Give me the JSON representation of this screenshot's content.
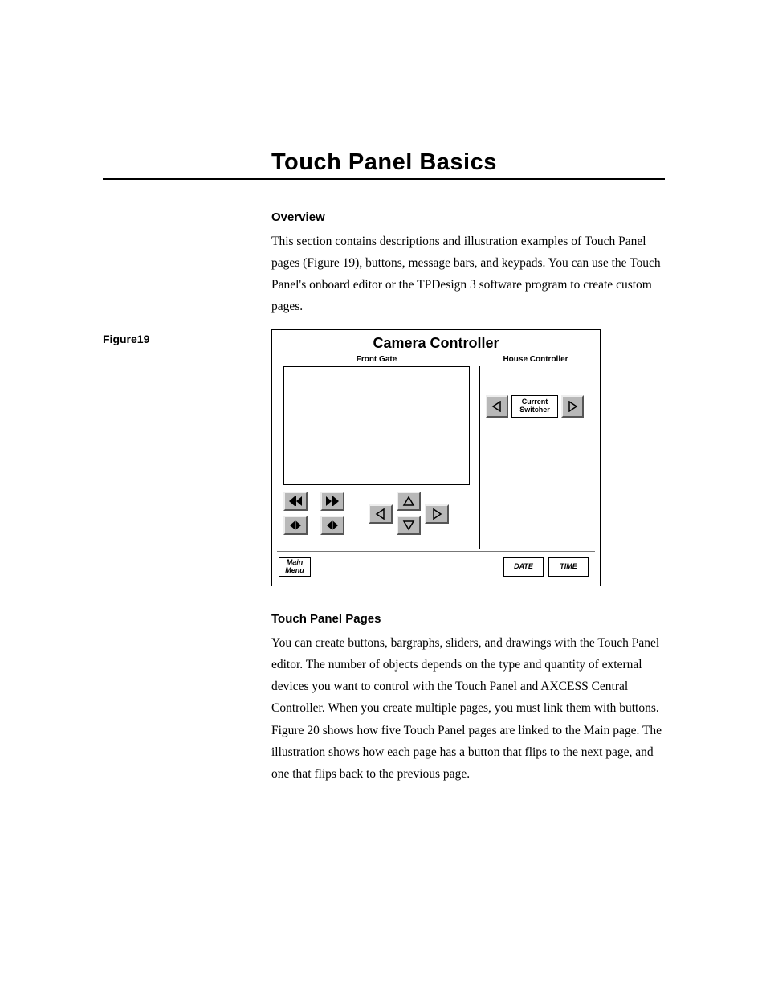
{
  "title": "Touch Panel Basics",
  "sections": {
    "overview": {
      "heading": "Overview",
      "body": "This section contains descriptions and illustration examples of Touch Panel pages (Figure 19), buttons, message bars, and keypads. You can use the Touch Panel's onboard editor or the TPDesign 3 software program to create custom pages."
    },
    "pages": {
      "heading": "Touch Panel Pages",
      "body": "You can create buttons, bargraphs, sliders, and drawings with the Touch Panel editor. The number of objects depends on the type and quantity of external devices you want to control with the Touch Panel and AXCESS Central Controller. When you create multiple pages, you must link them with buttons. Figure 20 shows how five Touch Panel pages are linked to the Main page. The illustration shows how each page has a button that flips to the next page, and one that flips back to the previous page."
    }
  },
  "figure": {
    "caption": "Figure19",
    "title": "Camera Controller",
    "labels": {
      "left": "Front Gate",
      "right": "House Controller",
      "switcher": "Current Switcher",
      "main_menu": "Main Menu",
      "date": "DATE",
      "time": "TIME"
    }
  }
}
